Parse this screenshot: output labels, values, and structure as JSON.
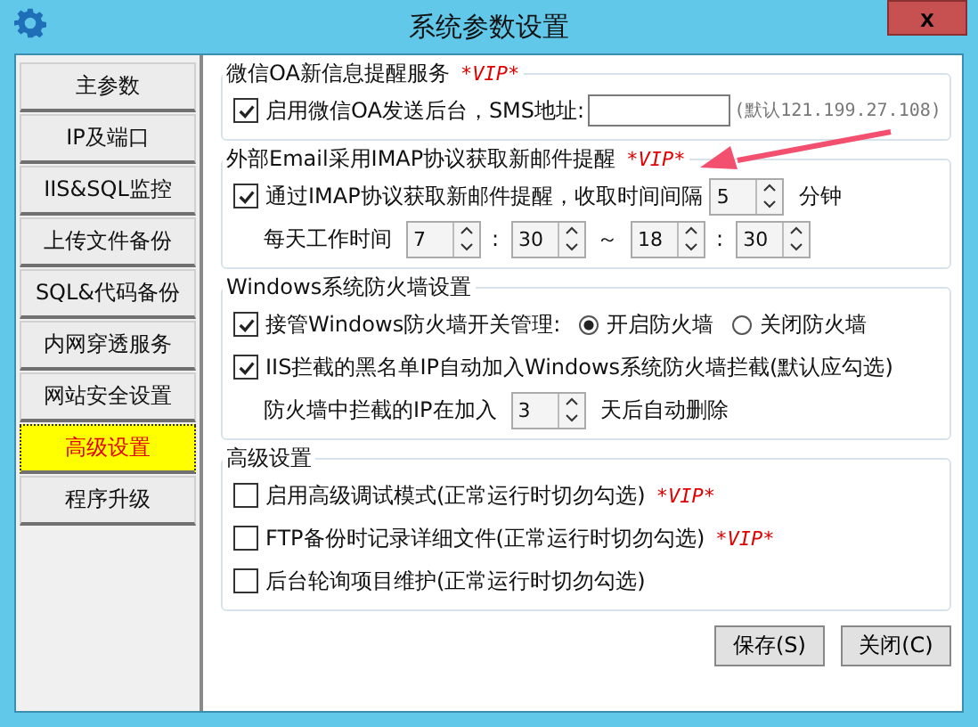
{
  "window": {
    "title": "系统参数设置",
    "close_label": "x"
  },
  "sidebar": {
    "items": [
      {
        "label": "主参数",
        "selected": false
      },
      {
        "label": "IP及端口",
        "selected": false
      },
      {
        "label": "IIS&SQL监控",
        "selected": false
      },
      {
        "label": "上传文件备份",
        "selected": false
      },
      {
        "label": "SQL&代码备份",
        "selected": false
      },
      {
        "label": "内网穿透服务",
        "selected": false
      },
      {
        "label": "网站安全设置",
        "selected": false
      },
      {
        "label": "高级设置",
        "selected": true
      },
      {
        "label": "程序升级",
        "selected": false
      }
    ]
  },
  "sections": [
    {
      "title": "微信OA新信息提醒服务",
      "vip": "*VIP*",
      "rows": [
        {
          "kind": "check_field",
          "checked": true,
          "label": "启用微信OA发送后台，SMS地址:",
          "hint": "(默认121.199.27.108)"
        }
      ]
    },
    {
      "title": "外部Email采用IMAP协议获取新邮件提醒",
      "vip": "*VIP*",
      "rows": [
        {
          "kind": "check_spin",
          "checked": true,
          "label": "通过IMAP协议获取新邮件提醒，收取时间间隔",
          "spin": "5",
          "unit": "分钟"
        },
        {
          "kind": "time",
          "label": "每天工作时间",
          "spins": [
            "7",
            "30",
            "18",
            "30"
          ],
          "seps": [
            ":",
            "～",
            ":"
          ]
        }
      ]
    },
    {
      "title": "Windows系统防火墙设置",
      "rows": [
        {
          "kind": "check_radio",
          "checked": true,
          "label": "接管Windows防火墙开关管理:",
          "options": [
            {
              "label": "开启防火墙",
              "selected": true
            },
            {
              "label": "关闭防火墙",
              "selected": false
            }
          ]
        },
        {
          "kind": "check",
          "checked": true,
          "label": "IIS拦截的黑名单IP自动加入Windows系统防火墙拦截(默认应勾选)"
        },
        {
          "kind": "spin",
          "label": "防火墙中拦截的IP在加入",
          "spin": "3",
          "unit": "天后自动删除"
        }
      ]
    },
    {
      "title": "高级设置",
      "rows": [
        {
          "kind": "check",
          "checked": false,
          "label": "启用高级调试模式(正常运行时切勿勾选)",
          "vip": "*VIP*"
        },
        {
          "kind": "check",
          "checked": false,
          "label": "FTP备份时记录详细文件(正常运行时切勿勾选)",
          "vip": "*VIP*"
        },
        {
          "kind": "check",
          "checked": false,
          "label": "后台轮询项目维护(正常运行时切勿勾选)"
        }
      ]
    }
  ],
  "buttons": [
    "保存(S)",
    "关闭(C)"
  ]
}
